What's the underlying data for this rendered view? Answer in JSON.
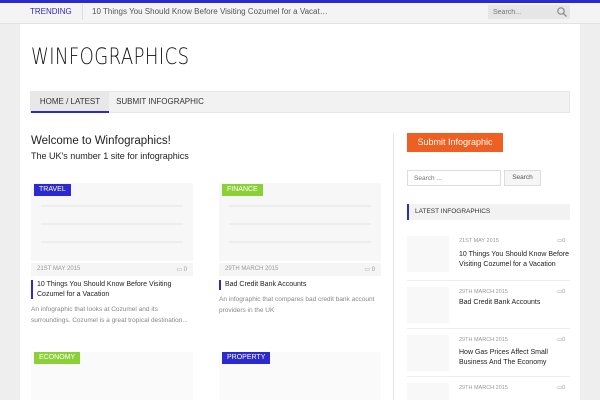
{
  "topbar": {
    "trending_label": "TRENDING",
    "trending_text": "10 Things You Should Know Before Visiting Cozumel for a Vacat…",
    "search_placeholder": "Search..."
  },
  "site": {
    "logo": "WINFOGRAPHICS"
  },
  "nav": {
    "items": [
      "HOME / LATEST",
      "SUBMIT INFOGRAPHIC"
    ]
  },
  "main": {
    "welcome": "Welcome to Winfographics!",
    "tagline": "The UK's number 1 site for infographics",
    "posts": [
      {
        "category": "TRAVEL",
        "category_color": "#2a2ad0",
        "date": "21ST MAY 2015",
        "comments": "0",
        "title": "10 Things You Should Know Before Visiting Cozumel for a Vacation",
        "excerpt": "An infographic that looks at Cozumel and its surroundings. Cozumel is a great tropical destination..."
      },
      {
        "category": "FINANCE",
        "category_color": "#8cd038",
        "date": "29TH MARCH 2015",
        "comments": "0",
        "title": "Bad Credit Bank Accounts",
        "excerpt": "An infographic that compares bad credit bank account providers in the UK"
      },
      {
        "category": "ECONOMY",
        "category_color": "#8cd038"
      },
      {
        "category": "PROPERTY",
        "category_color": "#2a2ad0"
      }
    ]
  },
  "sidebar": {
    "submit_button": "Submit Infographic",
    "search_placeholder": "Search ...",
    "search_button": "Search",
    "latest_heading": "LATEST INFOGRAPHICS",
    "latest": [
      {
        "date": "21ST MAY 2015",
        "comments": "0",
        "title": "10 Things You Should Know Before Visiting Cozumel for a Vacation"
      },
      {
        "date": "29TH MARCH 2015",
        "comments": "0",
        "title": "Bad Credit Bank Accounts"
      },
      {
        "date": "29TH MARCH 2015",
        "comments": "0",
        "title": "How Gas Prices Affect Small Business And The Economy"
      },
      {
        "date": "29TH MARCH 2015",
        "comments": "0",
        "title": ""
      }
    ]
  },
  "colors": {
    "accent": "#2a2ad0",
    "submit": "#ef5f21",
    "green": "#8cd038"
  }
}
